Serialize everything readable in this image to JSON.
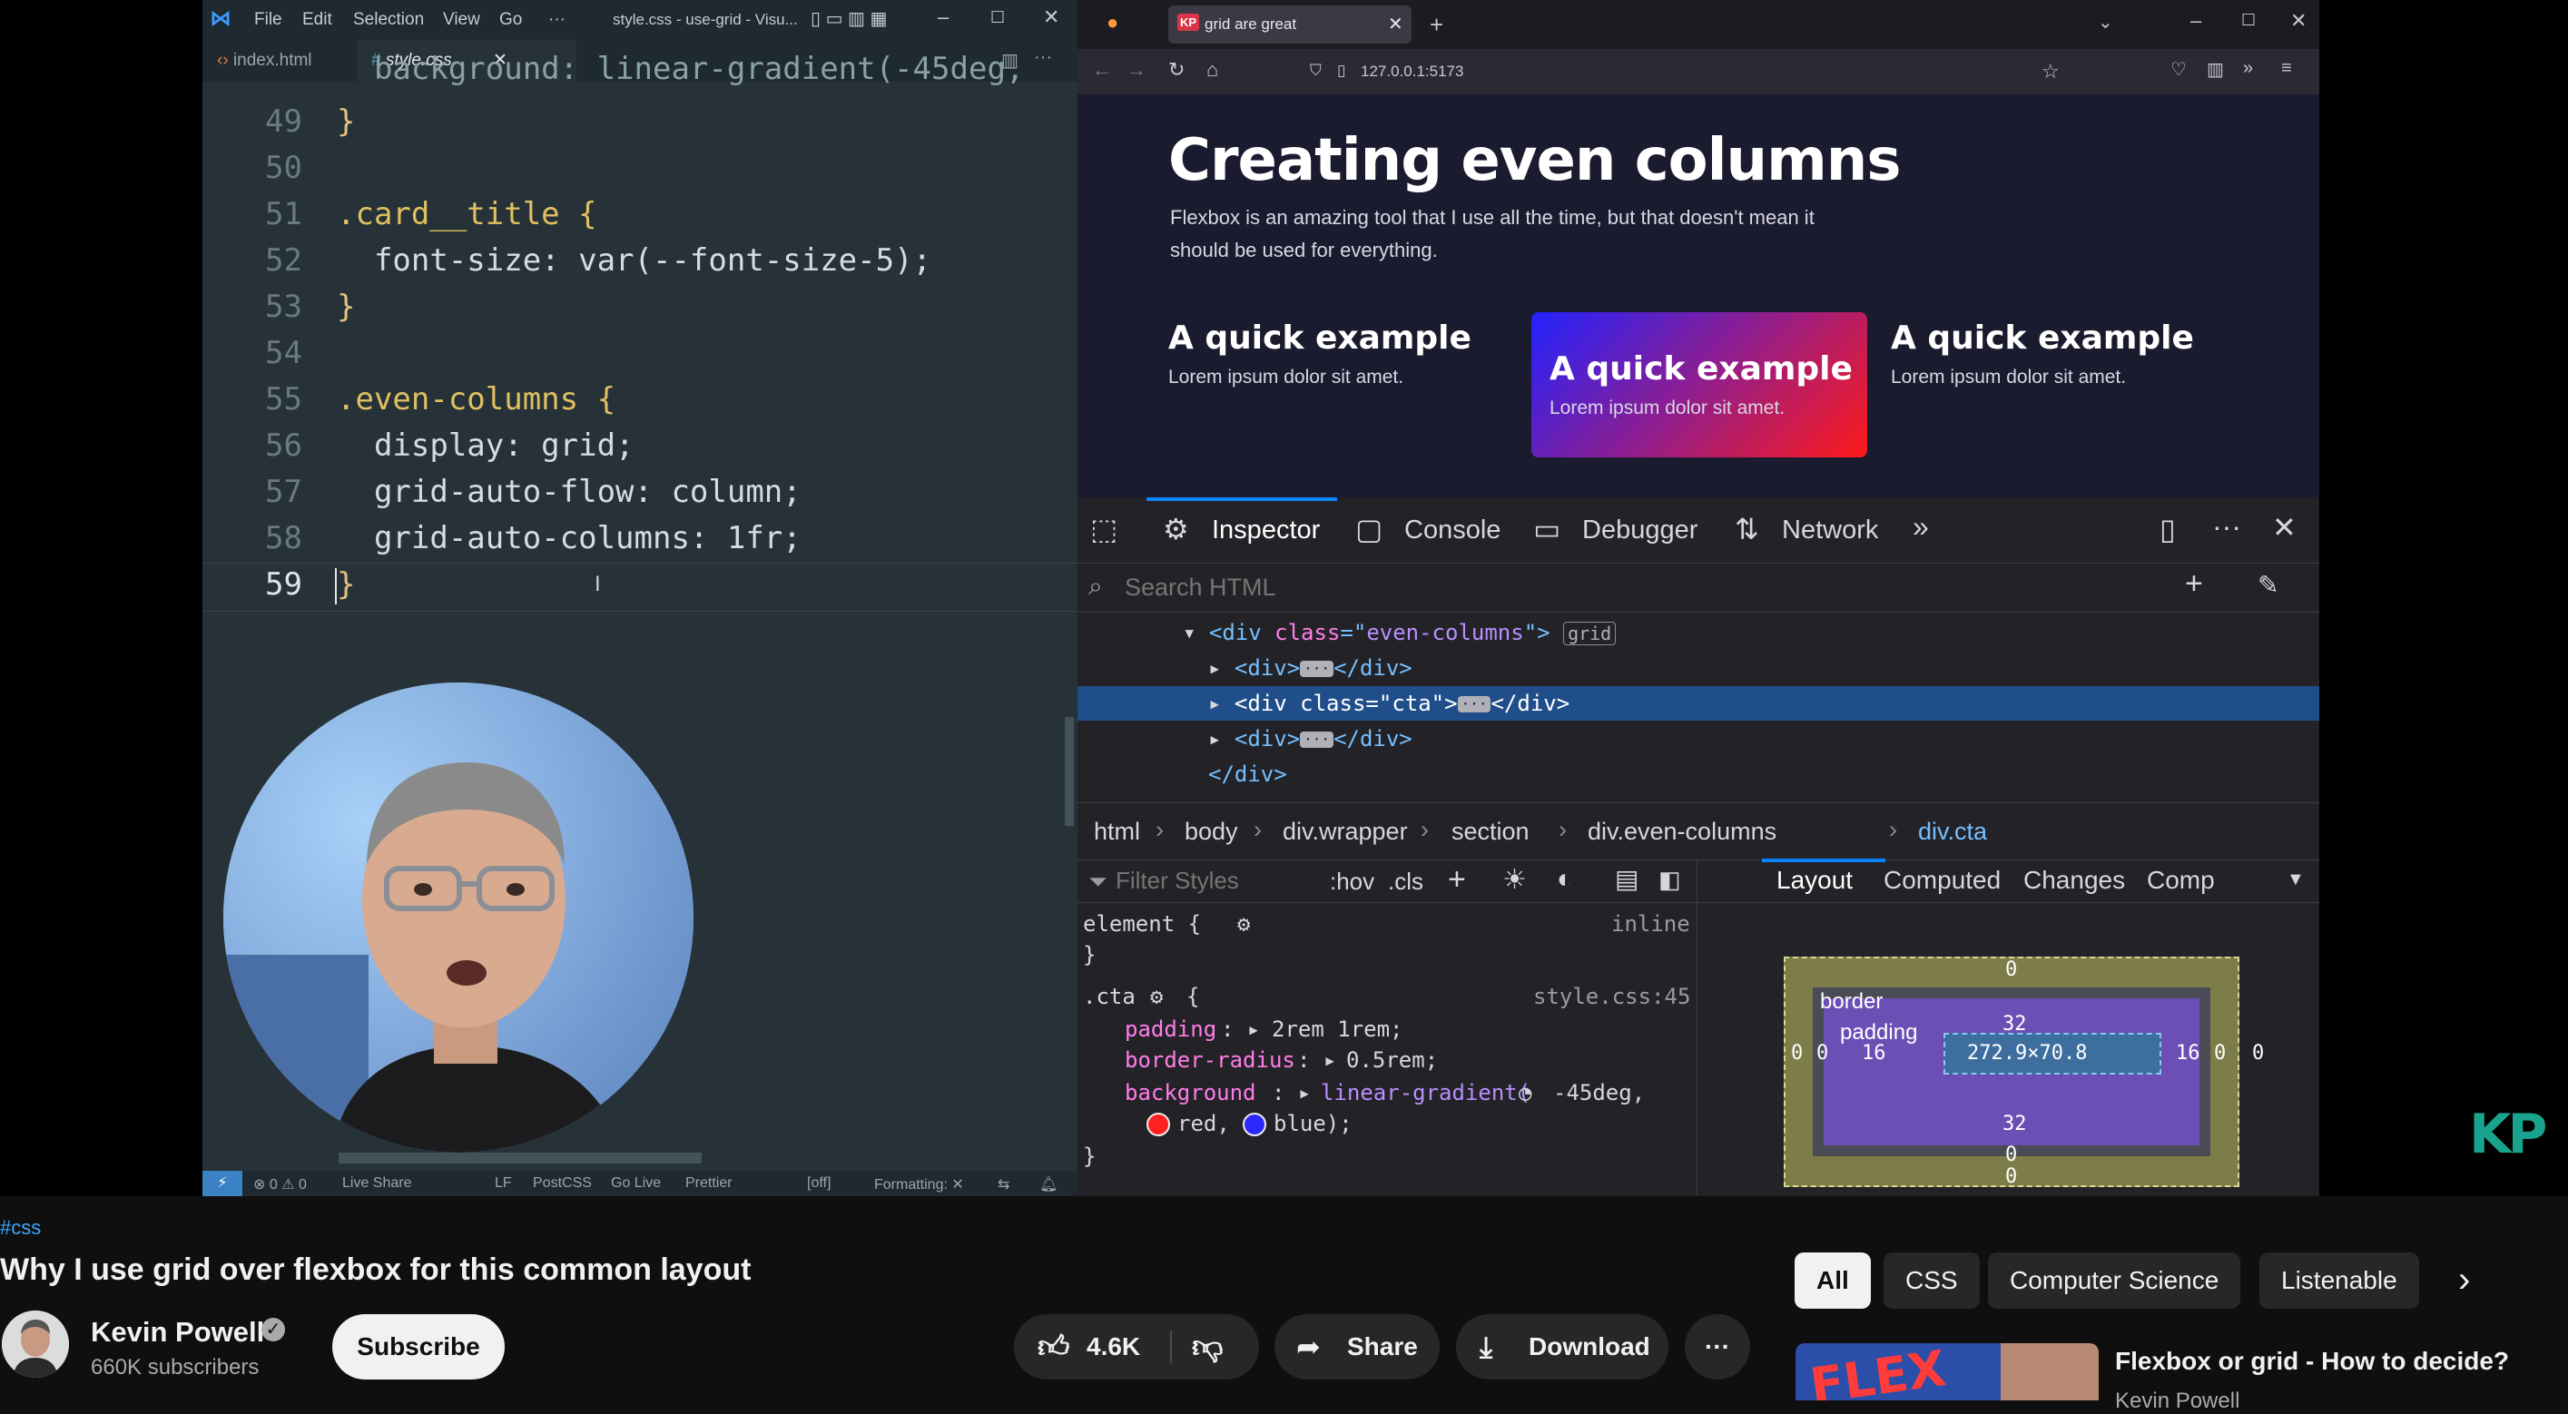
{
  "vscode": {
    "menu": [
      "File",
      "Edit",
      "Selection",
      "View",
      "Go",
      "···"
    ],
    "window_title": "style.css - use-grid - Visu...",
    "tabs": [
      {
        "label": "index.html",
        "icon": "html-icon"
      },
      {
        "label": "style.css",
        "icon": "css-hash-icon"
      }
    ],
    "partial_line": "  background: linear-gradient(-45deg,",
    "lines": [
      {
        "num": "49",
        "text": "}"
      },
      {
        "num": "50",
        "text": ""
      },
      {
        "num": "51",
        "text": ".card__title {"
      },
      {
        "num": "52",
        "text": "  font-size: var(--font-size-5);"
      },
      {
        "num": "53",
        "text": "}"
      },
      {
        "num": "54",
        "text": ""
      },
      {
        "num": "55",
        "text": ".even-columns {"
      },
      {
        "num": "56",
        "text": "  display: grid;"
      },
      {
        "num": "57",
        "text": "  grid-auto-flow: column;"
      },
      {
        "num": "58",
        "text": "  grid-auto-columns: 1fr;"
      },
      {
        "num": "59",
        "text": "}"
      }
    ],
    "status": {
      "problems": "⊗ 0 ⚠ 0",
      "live_share": "Live Share",
      "eol": "LF",
      "language": "PostCSS",
      "go_live": "Go Live",
      "prettier": "Prettier",
      "off": "[off]",
      "formatting": "Formatting: ✕"
    }
  },
  "firefox": {
    "tab_title": "grid are great",
    "url": "127.0.0.1:5173",
    "page": {
      "heading": "Creating even columns",
      "intro": "Flexbox is an amazing tool that I use all the time, but that doesn't mean it should be used for everything.",
      "cards": [
        {
          "title": "A quick example",
          "text": "Lorem ipsum dolor sit amet."
        },
        {
          "title": "A quick example",
          "text": "Lorem ipsum dolor sit amet."
        },
        {
          "title": "A quick example",
          "text": "Lorem ipsum dolor sit amet."
        }
      ]
    }
  },
  "devtools": {
    "tabs": [
      "Inspector",
      "Console",
      "Debugger",
      "Network"
    ],
    "search_placeholder": "Search HTML",
    "tree": {
      "row1_class": "even-columns",
      "row1_badge": "grid",
      "row3_class": "cta",
      "close": "</div>"
    },
    "breadcrumbs": [
      "html",
      "body",
      "div.wrapper",
      "section",
      "div.even-columns",
      "div.cta"
    ],
    "rules": {
      "filter_placeholder": "Filter Styles",
      "hov": ":hov",
      "cls": ".cls",
      "element_selector": "element {",
      "element_source": "inline",
      "close_brace": "}",
      "cta_selector": ".cta",
      "cta_source": "style.css:45",
      "padding_name": "padding",
      "padding_value": "2rem 1rem;",
      "radius_name": "border-radius",
      "radius_value": "0.5rem;",
      "bg_name": "background",
      "bg_fn": "linear-gradient(",
      "bg_angle": "-45deg,",
      "bg_c1": "red,",
      "bg_c2": "blue);",
      "color_red": "#ff2020",
      "color_blue": "#2a2aff"
    },
    "side_tabs": [
      "Layout",
      "Computed",
      "Changes",
      "Comp"
    ],
    "box_model": {
      "border_label": "border",
      "padding_label": "padding",
      "content_size": "272.9×70.8",
      "margin_top": "0",
      "margin_bottom": "0",
      "margin_left": "0",
      "margin_right": "0",
      "border_top": "0",
      "border_bottom": "0",
      "border_left": "0",
      "border_right": "0",
      "padding_top": "32",
      "padding_bottom": "32",
      "padding_left": "16",
      "padding_right": "16"
    }
  },
  "watermark": "KP",
  "youtube": {
    "hashtag": "#css",
    "title": "Why I use grid over flexbox for this common layout",
    "channel": "Kevin Powell",
    "subscribers": "660K subscribers",
    "subscribe": "Subscribe",
    "likes": "4.6K",
    "share": "Share",
    "download": "Download",
    "more": "···",
    "chips": [
      "All",
      "CSS",
      "Computer Science",
      "Listenable"
    ],
    "recommended": {
      "title": "Flexbox or grid - How to decide?",
      "channel": "Kevin Powell",
      "thumb_text": "FLEX"
    }
  }
}
